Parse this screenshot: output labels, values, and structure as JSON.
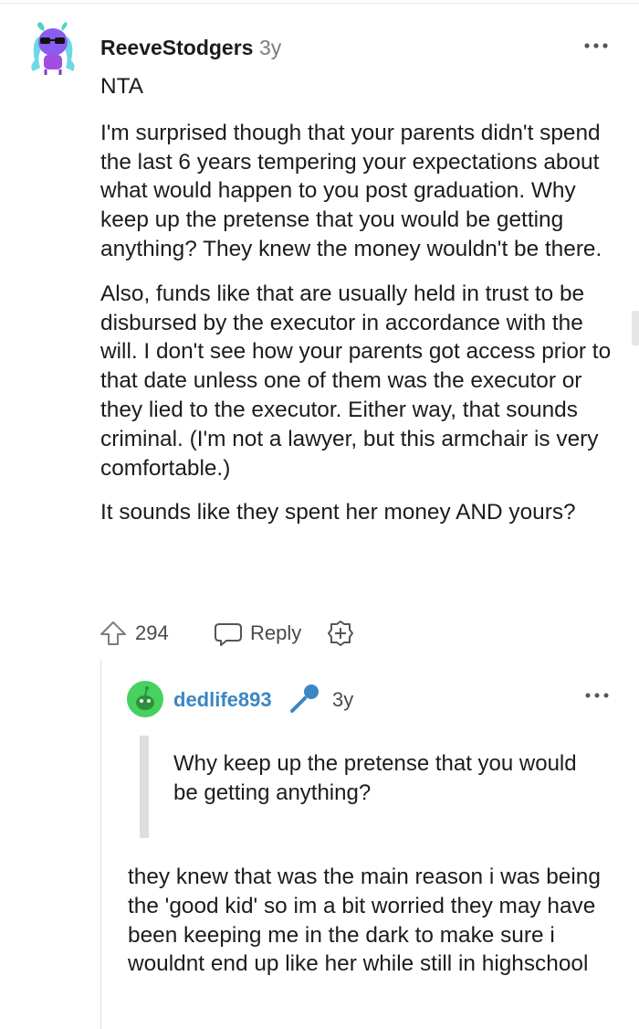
{
  "comment": {
    "author": "ReeveStodgers",
    "age": "3y",
    "paragraphs": [
      "NTA",
      "I'm surprised though that your parents didn't spend the last 6 years tempering your expectations about what would happen to you post graduation. Why keep up the pretense that you would be getting anything? They knew the money wouldn't be there.",
      "Also, funds like that are usually held in trust to be disbursed by the executor in accordance with the will. I don't see how your parents got access prior to that date unless one of them was the executor or they lied to the executor. Either way, that sounds criminal. (I'm not a lawyer, but this armchair is very comfortable.)",
      "It sounds like they spent her money AND yours?"
    ],
    "score": "294",
    "reply_label": "Reply"
  },
  "reply": {
    "author": "dedlife893",
    "age": "3y",
    "quote": "Why keep up the pretense that you would be getting anything?",
    "text": "they knew that was the main reason i was being the 'good kid' so im a bit worried they may have been keeping me in the dark to make sure i wouldnt end up like her while still in highschool"
  },
  "icons": [
    "avatar",
    "more-options-icon",
    "upvote-icon",
    "reply-icon",
    "award-icon",
    "microphone-icon"
  ],
  "colors": {
    "reply_author": "#3b86c4",
    "avatar_purple": "#8a5cf0",
    "avatar_green": "#46d160"
  }
}
